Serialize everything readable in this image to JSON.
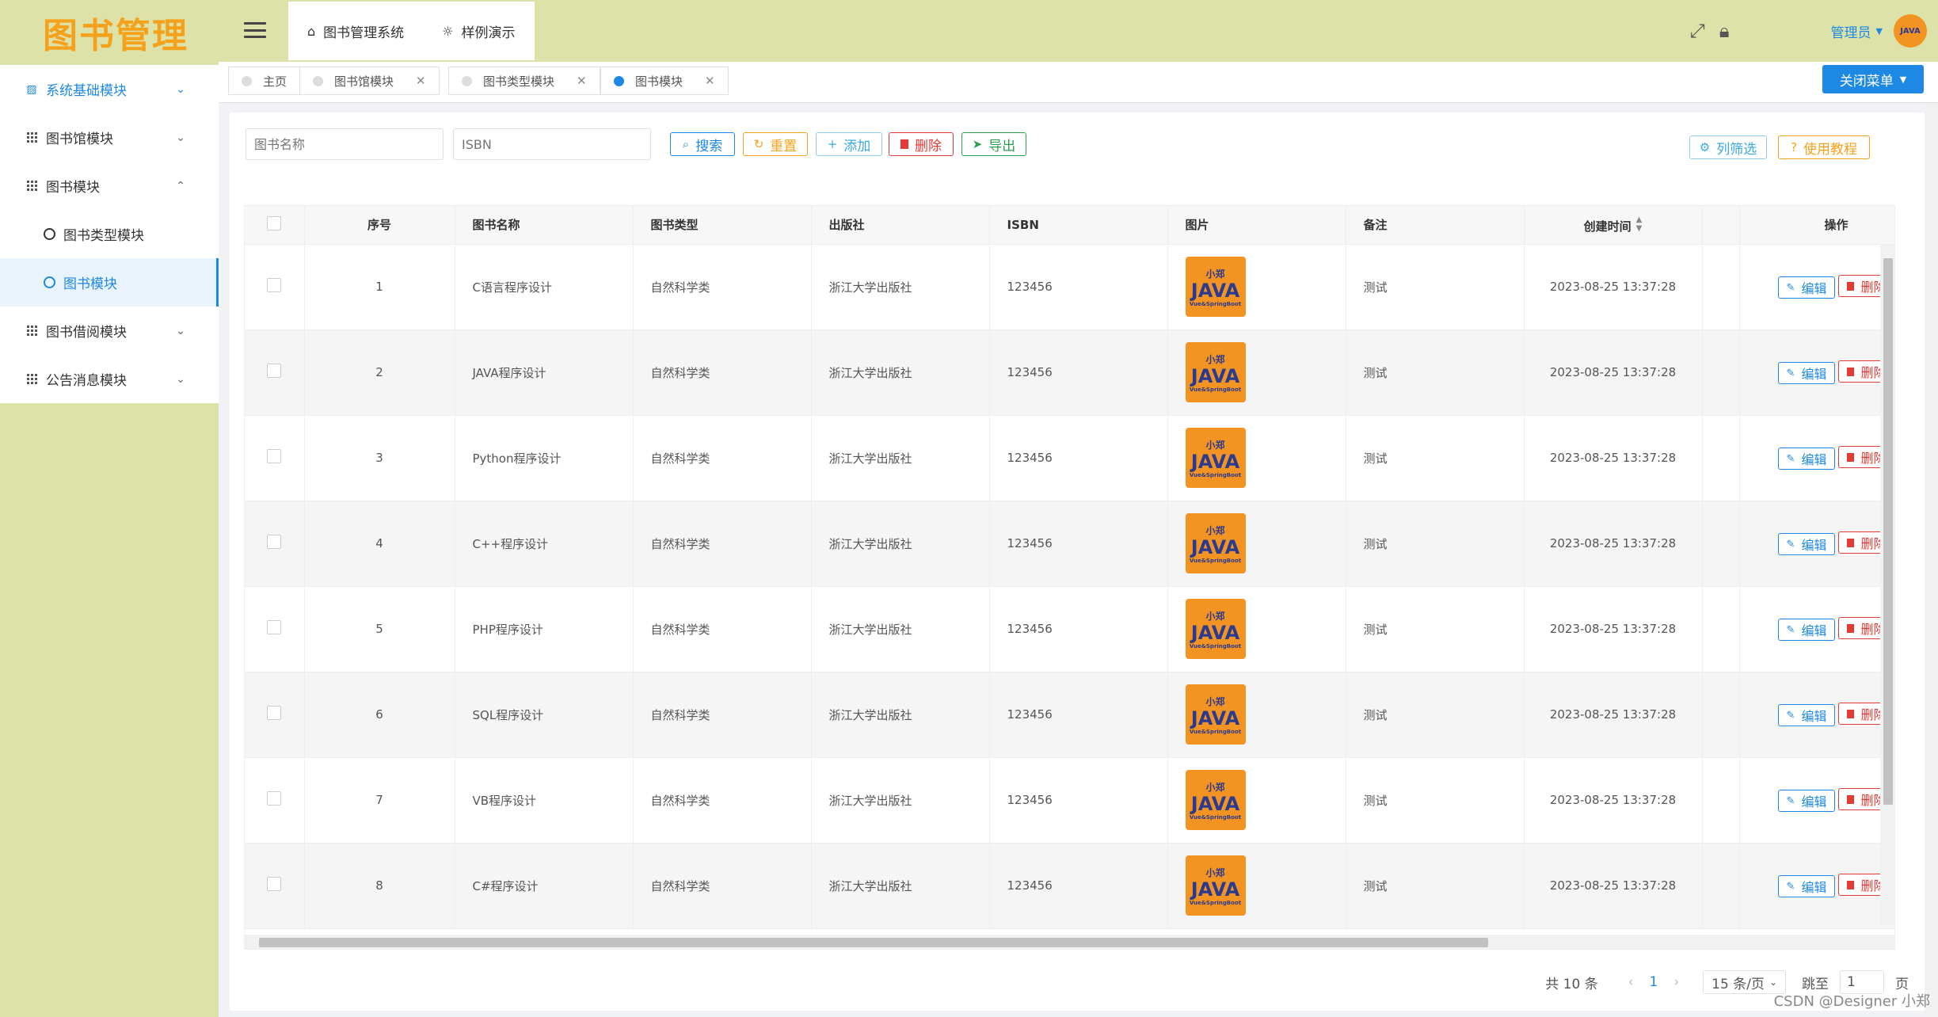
{
  "app": {
    "logo_text": "图书管理",
    "brand_color": "#f5a11c",
    "accent_color": "#1e88e5",
    "theme_color": "#dde3a8"
  },
  "sidebar": {
    "items": [
      {
        "label": "系统基础模块",
        "icon": "chart-icon",
        "expanded": false
      },
      {
        "label": "图书馆模块",
        "icon": "grid-icon",
        "expanded": false
      },
      {
        "label": "图书模块",
        "icon": "grid-icon",
        "expanded": true
      },
      {
        "label": "图书类型模块",
        "icon": "gear-icon",
        "sub": true
      },
      {
        "label": "图书模块",
        "icon": "gear-icon",
        "sub": true,
        "selected": true
      },
      {
        "label": "图书借阅模块",
        "icon": "grid-icon",
        "expanded": false
      },
      {
        "label": "公告消息模块",
        "icon": "grid-icon",
        "expanded": false
      }
    ]
  },
  "header": {
    "tabs": [
      {
        "label": "图书管理系统",
        "icon": "home-icon"
      },
      {
        "label": "样例演示",
        "icon": "bulb-icon"
      }
    ],
    "user": "管理员",
    "avatar_text": "JAVA"
  },
  "page_tabs": [
    {
      "label": "主页",
      "closable": false
    },
    {
      "label": "图书馆模块",
      "closable": true
    },
    {
      "label": "图书类型模块",
      "closable": true
    },
    {
      "label": "图书模块",
      "closable": true,
      "active": true
    }
  ],
  "close_menu_label": "关闭菜单",
  "search": {
    "name_placeholder": "图书名称",
    "isbn_placeholder": "ISBN"
  },
  "toolbar": {
    "search": "搜索",
    "reset": "重置",
    "add": "添加",
    "delete": "删除",
    "export": "导出",
    "columns": "列筛选",
    "tutorial": "使用教程"
  },
  "table": {
    "headers": [
      "序号",
      "图书名称",
      "图书类型",
      "出版社",
      "ISBN",
      "图片",
      "备注",
      "创建时间",
      "操作"
    ],
    "image": {
      "line1": "小郑",
      "line2": "JAVA",
      "line3": "Vue&SpringBoot"
    },
    "edit_label": "编辑",
    "delete_label": "删除",
    "rows": [
      {
        "no": "1",
        "name": "C语言程序设计",
        "type": "自然科学类",
        "publisher": "浙江大学出版社",
        "isbn": "123456",
        "note": "测试",
        "created": "2023-08-25 13:37:28"
      },
      {
        "no": "2",
        "name": "JAVA程序设计",
        "type": "自然科学类",
        "publisher": "浙江大学出版社",
        "isbn": "123456",
        "note": "测试",
        "created": "2023-08-25 13:37:28"
      },
      {
        "no": "3",
        "name": "Python程序设计",
        "type": "自然科学类",
        "publisher": "浙江大学出版社",
        "isbn": "123456",
        "note": "测试",
        "created": "2023-08-25 13:37:28"
      },
      {
        "no": "4",
        "name": "C++程序设计",
        "type": "自然科学类",
        "publisher": "浙江大学出版社",
        "isbn": "123456",
        "note": "测试",
        "created": "2023-08-25 13:37:28"
      },
      {
        "no": "5",
        "name": "PHP程序设计",
        "type": "自然科学类",
        "publisher": "浙江大学出版社",
        "isbn": "123456",
        "note": "测试",
        "created": "2023-08-25 13:37:28"
      },
      {
        "no": "6",
        "name": "SQL程序设计",
        "type": "自然科学类",
        "publisher": "浙江大学出版社",
        "isbn": "123456",
        "note": "测试",
        "created": "2023-08-25 13:37:28"
      },
      {
        "no": "7",
        "name": "VB程序设计",
        "type": "自然科学类",
        "publisher": "浙江大学出版社",
        "isbn": "123456",
        "note": "测试",
        "created": "2023-08-25 13:37:28"
      },
      {
        "no": "8",
        "name": "C#程序设计",
        "type": "自然科学类",
        "publisher": "浙江大学出版社",
        "isbn": "123456",
        "note": "测试",
        "created": "2023-08-25 13:37:28"
      }
    ]
  },
  "pagination": {
    "total": "共 10 条",
    "current": "1",
    "page_size": "15 条/页",
    "jump_label": "跳至",
    "jump_value": "1",
    "page_suffix": "页"
  },
  "watermark": "CSDN @Designer 小郑"
}
